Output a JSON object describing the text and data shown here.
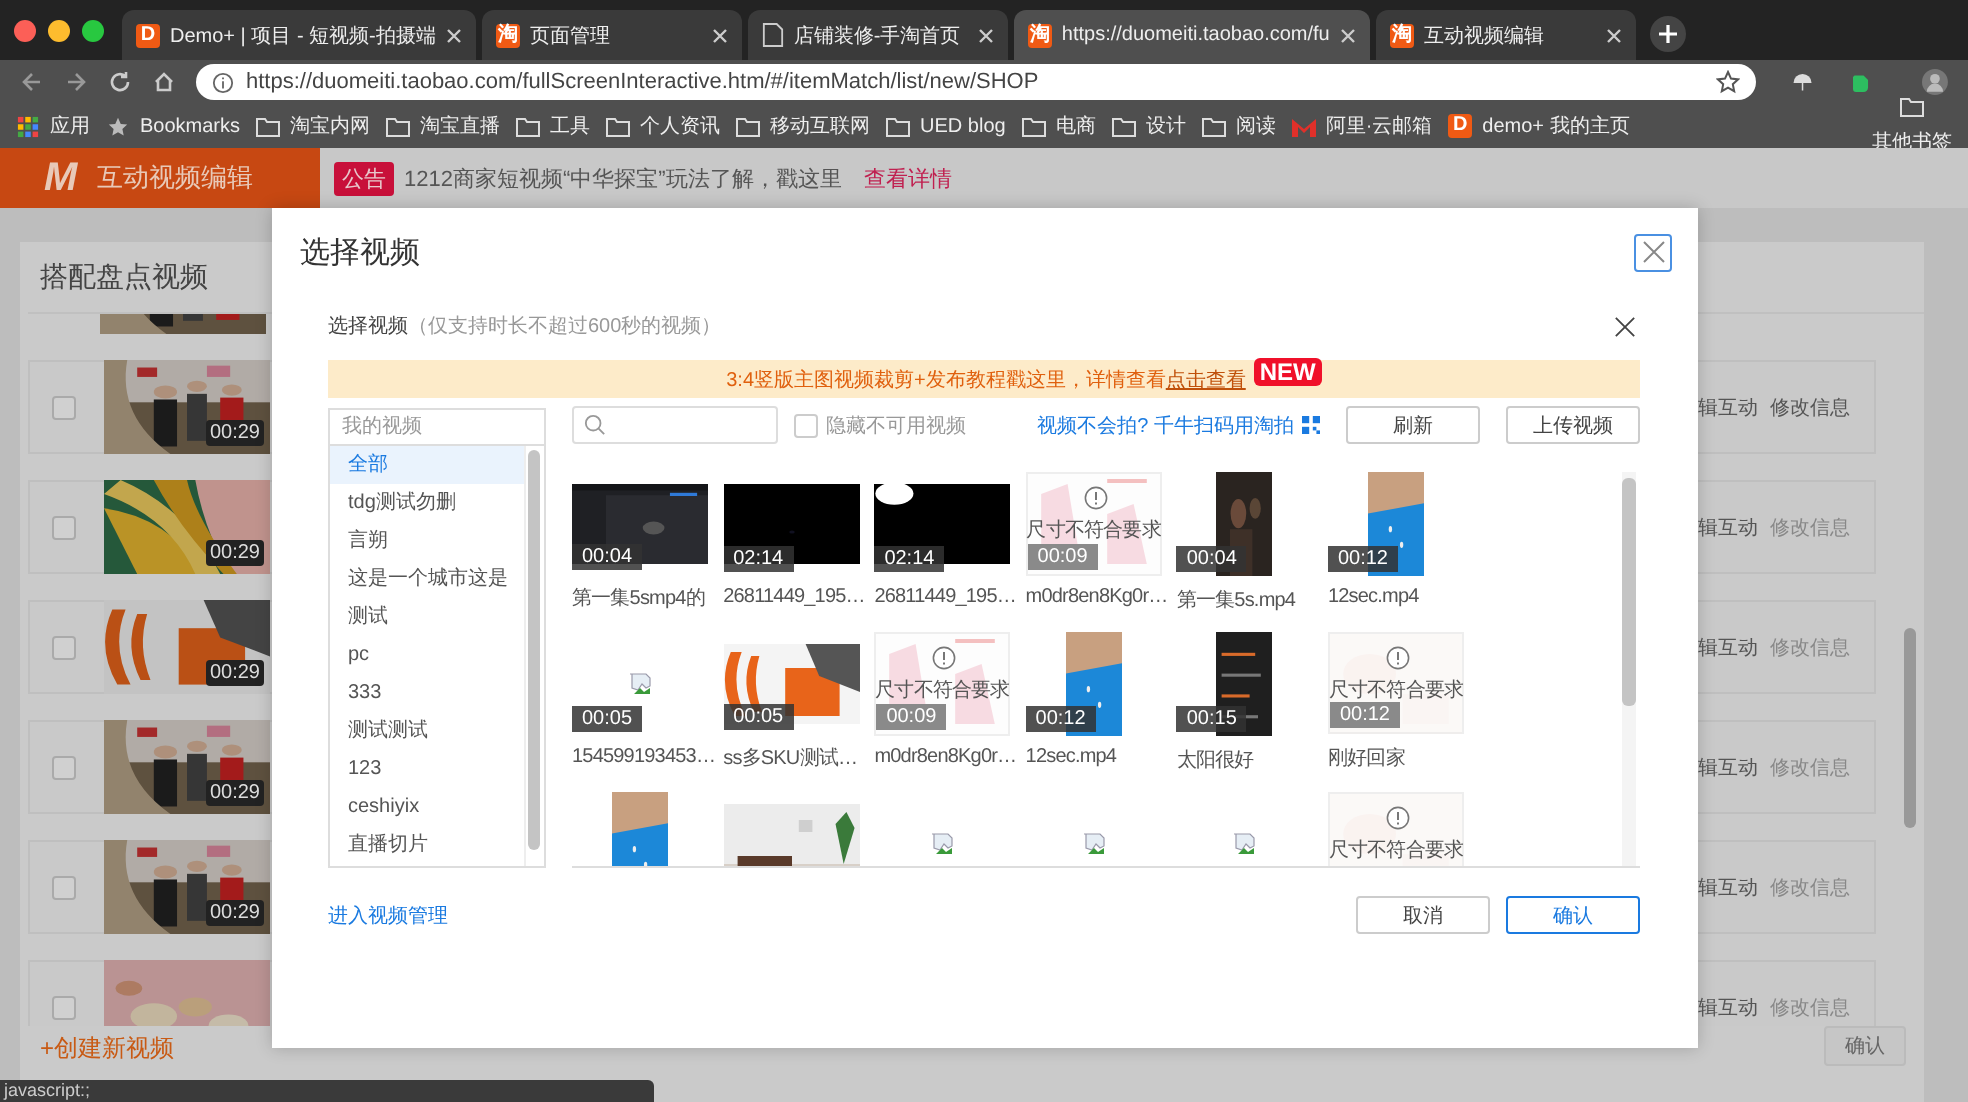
{
  "browser": {
    "tabs": [
      {
        "icon_text": "D",
        "title": "Demo+ | 项目 - 短视频-拍摄端",
        "selected": false
      },
      {
        "icon_text": "淘",
        "title": "页面管理",
        "selected": false
      },
      {
        "title": "店铺装修-手淘首页",
        "selected": false
      },
      {
        "icon_text": "淘",
        "title": "https://duomeiti.taobao.com/fu",
        "selected": true
      },
      {
        "icon_text": "淘",
        "title": "互动视频编辑",
        "selected": false
      }
    ],
    "url": "https://duomeiti.taobao.com/fullScreenInteractive.htm/#/itemMatch/list/new/SHOP",
    "bookmarks": [
      {
        "kind": "apps",
        "label": "应用"
      },
      {
        "kind": "star",
        "label": "Bookmarks"
      },
      {
        "kind": "folder",
        "label": "淘宝内网"
      },
      {
        "kind": "folder",
        "label": "淘宝直播"
      },
      {
        "kind": "folder",
        "label": "工具"
      },
      {
        "kind": "folder",
        "label": "个人资讯"
      },
      {
        "kind": "folder",
        "label": "移动互联网"
      },
      {
        "kind": "folder",
        "label": "UED blog"
      },
      {
        "kind": "folder",
        "label": "电商"
      },
      {
        "kind": "folder",
        "label": "设计"
      },
      {
        "kind": "folder",
        "label": "阅读"
      },
      {
        "kind": "mail",
        "label": "阿里·云邮箱"
      },
      {
        "kind": "letter",
        "icon_text": "D",
        "label": "demo+ 我的主页"
      }
    ],
    "other_bookmarks": "其他书签"
  },
  "header": {
    "logo": "M",
    "title": "互动视频编辑",
    "notice": {
      "badge": "公告",
      "text": "1212商家短视频“中华探宝”玩法了解，戳这里",
      "link": "查看详情"
    }
  },
  "panel": {
    "title": "搭配盘点视频",
    "rows": [
      {
        "partial": true
      },
      {
        "checked": false,
        "duration": "00:29",
        "actions": [
          "辑互动",
          "修改信息"
        ],
        "highlighted": true
      },
      {
        "checked": false,
        "duration": "00:29",
        "actions": [
          "辑互动",
          "修改信息"
        ],
        "highlighted": false
      },
      {
        "checked": false,
        "duration": "00:29",
        "actions": [
          "辑互动",
          "修改信息"
        ],
        "highlighted": false
      },
      {
        "checked": false,
        "duration": "00:29",
        "actions": [
          "辑互动",
          "修改信息"
        ],
        "highlighted": false
      },
      {
        "checked": false,
        "duration": "00:29",
        "actions": [
          "辑互动",
          "修改信息"
        ],
        "highlighted": false
      },
      {
        "checked": false,
        "actions": [
          "辑互动",
          "修改信息"
        ],
        "highlighted": false
      }
    ],
    "create_link": "+创建新视频",
    "confirm": {
      "label": "确认",
      "disabled": true
    }
  },
  "modal": {
    "title": "选择视频",
    "subtitle": "选择视频",
    "hint": "（仅支持时长不超过600秒的视频）",
    "banner": {
      "text": "3:4竖版主图视频裁剪+发布教程戳这里，详情查看",
      "link": "点击查看",
      "badge": "NEW"
    },
    "folder_search": {
      "placeholder": "我的视频"
    },
    "folders": [
      {
        "label": "全部",
        "selected": true
      },
      {
        "label": "tdg测试勿删",
        "selected": false
      },
      {
        "label": "言朔",
        "selected": false
      },
      {
        "label": "这是一个城市这是",
        "selected": false
      },
      {
        "label": "测试",
        "selected": false
      },
      {
        "label": "pc",
        "selected": false
      },
      {
        "label": "333",
        "selected": false
      },
      {
        "label": "测试测试",
        "selected": false
      },
      {
        "label": "123",
        "selected": false
      },
      {
        "label": "ceshiyix",
        "selected": false
      },
      {
        "label": "直播切片",
        "selected": false
      }
    ],
    "hide_unavailable": {
      "label": "隐藏不可用视频",
      "checked": false
    },
    "help_link": "视频不会拍? 千牛扫码用淘拍",
    "buttons": [
      "刷新",
      "上传视频"
    ],
    "videos": [
      {
        "kind": "video",
        "duration": "00:04",
        "name": "第一集5smp4的"
      },
      {
        "kind": "video",
        "duration": "02:14",
        "name": "26811449_195…"
      },
      {
        "kind": "video",
        "duration": "02:14",
        "name": "26811449_195…"
      },
      {
        "kind": "unsupported",
        "warning": "尺寸不符合要求",
        "duration": "00:09",
        "name": "m0dr8en8Kg0r…"
      },
      {
        "kind": "video",
        "duration": "00:04",
        "name": "第一集5s.mp4"
      },
      {
        "kind": "video",
        "duration": "00:12",
        "name": "12sec.mp4"
      },
      {
        "kind": "broken",
        "duration": "00:05",
        "name": "154599193453…"
      },
      {
        "kind": "video",
        "duration": "00:05",
        "name": "ss多SKU测试…"
      },
      {
        "kind": "unsupported",
        "warning": "尺寸不符合要求",
        "duration": "00:09",
        "name": "m0dr8en8Kg0r…"
      },
      {
        "kind": "video",
        "duration": "00:12",
        "name": "12sec.mp4"
      },
      {
        "kind": "video",
        "duration": "00:15",
        "name": "太阳很好"
      },
      {
        "kind": "unsupported",
        "warning": "尺寸不符合要求",
        "duration": "00:12",
        "name": "刚好回家"
      },
      {
        "kind": "video"
      },
      {
        "kind": "video"
      },
      {
        "kind": "broken"
      },
      {
        "kind": "broken"
      },
      {
        "kind": "broken"
      },
      {
        "kind": "unsupported",
        "warning": "尺寸不符合要求"
      }
    ],
    "manage_link": "进入视频管理",
    "footer_buttons": [
      {
        "label": "取消",
        "primary": false
      },
      {
        "label": "确认",
        "primary": true
      }
    ]
  },
  "status_bar": "javascript:;"
}
